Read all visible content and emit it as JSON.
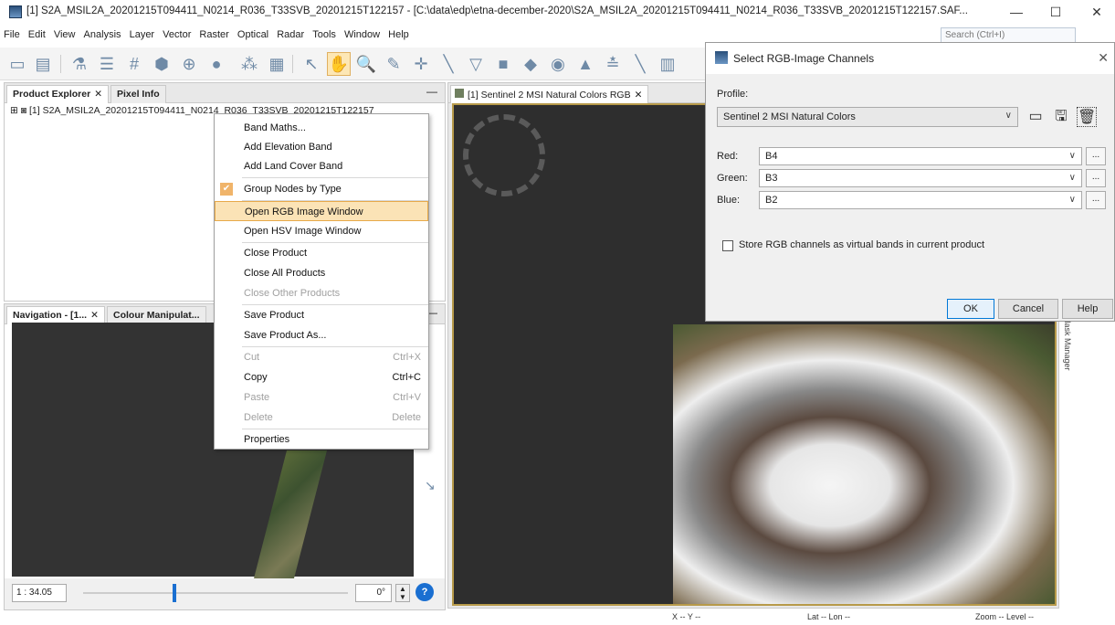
{
  "window": {
    "title": "[1] S2A_MSIL2A_20201215T094411_N0214_R036_T33SVB_20201215T122157 - [C:\\data\\edp\\etna-december-2020\\S2A_MSIL2A_20201215T094411_N0214_R036_T33SVB_20201215T122157.SAF...",
    "minimize": "—",
    "maximize": "☐",
    "close": "✕"
  },
  "menubar": [
    "File",
    "Edit",
    "View",
    "Analysis",
    "Layer",
    "Vector",
    "Raster",
    "Optical",
    "Radar",
    "Tools",
    "Window",
    "Help"
  ],
  "search": {
    "placeholder": "Search (Ctrl+I)"
  },
  "left_panel": {
    "tabs": [
      {
        "label": "Product Explorer",
        "close": "✕"
      },
      {
        "label": "Pixel Info"
      }
    ],
    "minimize": "—",
    "tree_item": "[1] S2A_MSIL2A_20201215T094411_N0214_R036_T33SVB_20201215T122157"
  },
  "nav_panel": {
    "tabs": [
      {
        "label": "Navigation - [1...",
        "close": "✕"
      },
      {
        "label": "Colour Manipulat..."
      }
    ],
    "minimize": "—",
    "scale": "1 : 34.05",
    "angle": "0°"
  },
  "image_view": {
    "tab_label": "[1] Sentinel 2 MSI Natural Colors RGB",
    "tab_close": "✕",
    "side_label": "Mask Manager"
  },
  "statusbar": {
    "x": "X  -- Y  --",
    "latlon": "Lat  -- Lon  --",
    "zoom": "Zoom -- Level --"
  },
  "context_menu": {
    "items": [
      {
        "label": "Band Maths...",
        "shortcut": "",
        "disabled": false
      },
      {
        "label": "Add Elevation Band",
        "shortcut": "",
        "disabled": false
      },
      {
        "label": "Add Land Cover Band",
        "shortcut": "",
        "disabled": false
      },
      {
        "label": "Group Nodes by Type",
        "shortcut": "",
        "checked": true
      },
      {
        "label": "Open RGB Image Window",
        "shortcut": "",
        "highlighted": true
      },
      {
        "label": "Open HSV Image Window",
        "shortcut": ""
      },
      {
        "label": "Close Product",
        "shortcut": ""
      },
      {
        "label": "Close All Products",
        "shortcut": ""
      },
      {
        "label": "Close Other Products",
        "shortcut": "",
        "disabled": true
      },
      {
        "label": "Save Product",
        "shortcut": ""
      },
      {
        "label": "Save Product As...",
        "shortcut": ""
      },
      {
        "label": "Cut",
        "shortcut": "Ctrl+X",
        "disabled": true
      },
      {
        "label": "Copy",
        "shortcut": "Ctrl+C"
      },
      {
        "label": "Paste",
        "shortcut": "Ctrl+V",
        "disabled": true
      },
      {
        "label": "Delete",
        "shortcut": "Delete",
        "disabled": true
      },
      {
        "label": "Properties",
        "shortcut": ""
      }
    ]
  },
  "dialog": {
    "title": "Select RGB-Image Channels",
    "close": "✕",
    "profile_label": "Profile:",
    "profile_value": "Sentinel 2 MSI Natural Colors",
    "channels": [
      {
        "label": "Red:",
        "value": "B4"
      },
      {
        "label": "Green:",
        "value": "B3"
      },
      {
        "label": "Blue:",
        "value": "B2"
      }
    ],
    "store_label": "Store RGB channels as virtual bands in current product",
    "buttons": {
      "ok": "OK",
      "cancel": "Cancel",
      "help": "Help"
    },
    "dots": "..."
  },
  "colors": {
    "accent": "#1a6fd1",
    "highlight": "#fbe3b6",
    "highlight_border": "#e7a94a"
  }
}
